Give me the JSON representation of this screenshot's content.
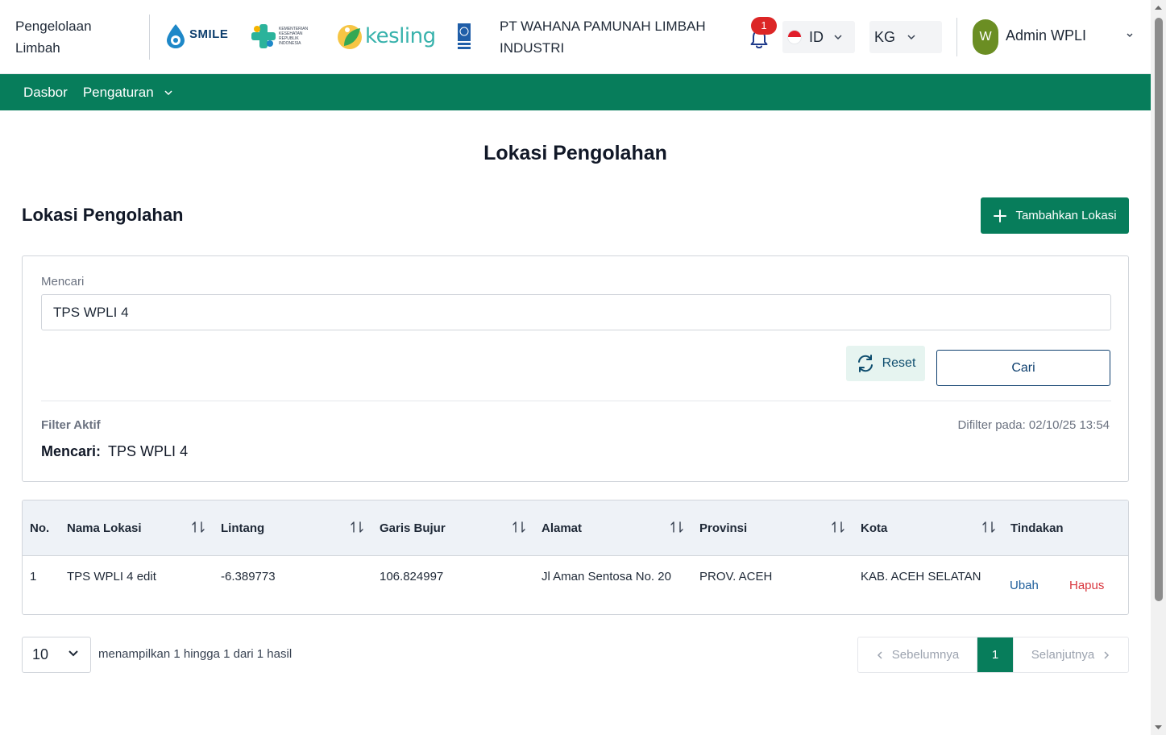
{
  "header": {
    "app_name": "Pengelolaan Limbah",
    "logos": {
      "smile": "SMILE",
      "kemenkes": "KEMENTERIAN KESEHATAN REPUBLIK INDONESIA",
      "kesling": "kesling"
    },
    "company": "PT WAHANA PAMUNAH LIMBAH INDUSTRI",
    "notification_count": "1",
    "language": "ID",
    "unit": "KG",
    "user_initial": "W",
    "user_name": "Admin WPLI"
  },
  "nav": {
    "items": [
      {
        "label": "Dasbor"
      },
      {
        "label": "Pengaturan"
      }
    ]
  },
  "page_title": "Lokasi Pengolahan",
  "section_title": "Lokasi Pengolahan",
  "add_button_label": "Tambahkan Lokasi",
  "filter": {
    "search_label": "Mencari",
    "search_value": "TPS WPLI 4",
    "reset_label": "Reset",
    "search_button_label": "Cari",
    "active_label": "Filter Aktif",
    "filtered_at": "Difilter pada: 02/10/25 13:54",
    "active_key": "Mencari:",
    "active_value": "TPS WPLI 4"
  },
  "table": {
    "columns": [
      "No.",
      "Nama Lokasi",
      "Lintang",
      "Garis Bujur",
      "Alamat",
      "Provinsi",
      "Kota",
      "Tindakan"
    ],
    "rows": [
      {
        "no": "1",
        "name": "TPS WPLI 4 edit",
        "lat": "-6.389773",
        "lng": "106.824997",
        "address": "Jl Aman Sentosa No. 20",
        "province": "PROV. ACEH",
        "city": "KAB. ACEH SELATAN",
        "edit": "Ubah",
        "delete": "Hapus"
      }
    ]
  },
  "footer": {
    "per_page": "10",
    "showing": "menampilkan 1 hingga 1 dari 1 hasil",
    "prev": "Sebelumnya",
    "current_page": "1",
    "next": "Selanjutnya"
  },
  "colors": {
    "primary": "#077d5b",
    "danger": "#dc2626",
    "link": "#1d5d9b"
  }
}
